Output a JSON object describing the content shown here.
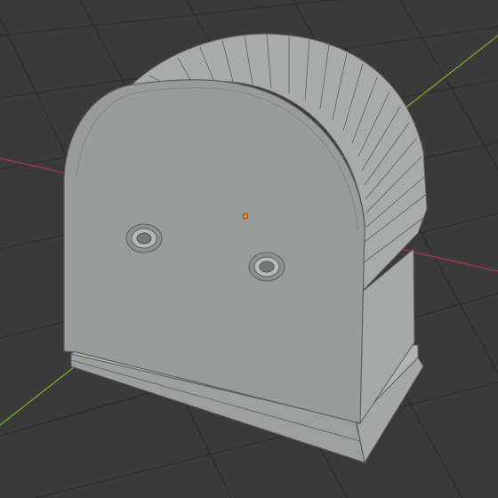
{
  "viewport": {
    "name": "3d-viewport",
    "background_color": "#3a3a3a",
    "grid_color": "#303030",
    "x_axis_color": "#9b3a43",
    "y_axis_color": "#6f9a2a"
  },
  "object": {
    "name": "arched-mesh-object",
    "face_color": "#9a9c9b",
    "side_face_color": "#a8aaa9",
    "edge_color": "#5d5f5e",
    "origin_color": "#f08c18",
    "holes": 2
  }
}
